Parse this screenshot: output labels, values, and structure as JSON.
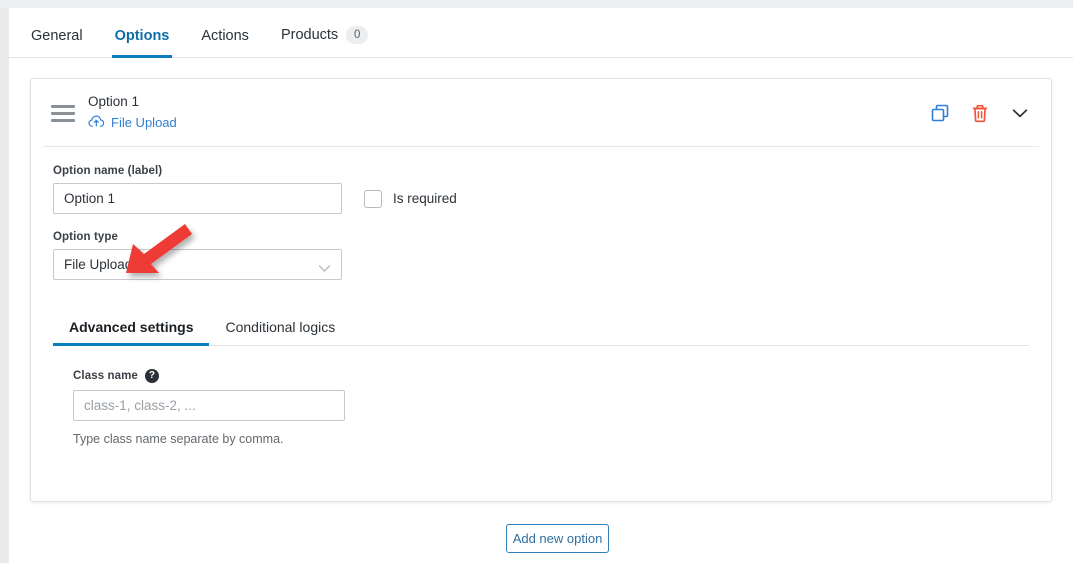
{
  "tabs": {
    "items": [
      {
        "label": "General",
        "active": false,
        "badge": null
      },
      {
        "label": "Options",
        "active": true,
        "badge": null
      },
      {
        "label": "Actions",
        "active": false,
        "badge": null
      },
      {
        "label": "Products",
        "active": false,
        "badge": "0"
      }
    ]
  },
  "option_card": {
    "title": "Option 1",
    "type_label": "File Upload",
    "type_icon": "cloud-upload-icon",
    "drag_handle_icon": "drag-handle-icon",
    "actions": {
      "duplicate_icon": "copy-icon",
      "delete_icon": "trash-icon",
      "collapse_icon": "chevron-down-icon"
    },
    "name_field": {
      "label": "Option name (label)",
      "value": "Option 1"
    },
    "required_checkbox": {
      "label": "Is required",
      "checked": false
    },
    "type_field": {
      "label": "Option type",
      "value": "File Upload",
      "chevron_icon": "chevron-down-icon"
    },
    "inner_tabs": [
      {
        "label": "Advanced settings",
        "active": true
      },
      {
        "label": "Conditional logics",
        "active": false
      }
    ],
    "advanced": {
      "class_name_label": "Class name",
      "help_icon": "question-mark-icon",
      "help_glyph": "?",
      "class_name_placeholder": "class-1, class-2, ...",
      "class_name_value": "",
      "hint": "Type class name separate by comma."
    }
  },
  "footer": {
    "add_option_label": "Add new option"
  },
  "annotation": {
    "arrow_icon": "red-arrow-pointer",
    "color": "#ef3b36"
  },
  "colors": {
    "accent_blue": "#0d7ebd",
    "link_blue": "#2f7fd6",
    "delete_red": "#f4533c",
    "page_bg": "#ffffff",
    "chrome_gray": "#eceef0"
  }
}
